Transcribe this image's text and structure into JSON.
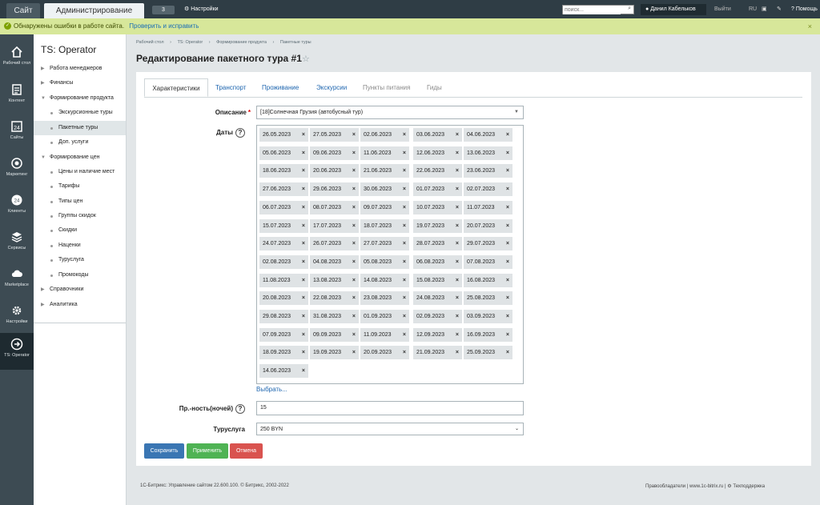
{
  "topbar": {
    "site_tab": "Сайт",
    "admin_tab": "Администрирование",
    "notifications_count": "3",
    "settings_label": "Настройки",
    "search_placeholder": "поиск...",
    "user_name": "Данил Кабельков",
    "logout_label": "Выйти",
    "lang_label": "RU",
    "help_label": "Помощь"
  },
  "errorbar": {
    "message": "Обнаружены ошибки в работе сайта.",
    "link": "Проверить и исправить",
    "close": "×"
  },
  "rail": [
    {
      "label": "Рабочий стол",
      "icon": "home-icon"
    },
    {
      "label": "Контент",
      "icon": "document-icon"
    },
    {
      "label": "Сайты",
      "icon": "calendar-24-icon"
    },
    {
      "label": "Маркетинг",
      "icon": "target-icon"
    },
    {
      "label": "Клиенты",
      "icon": "clock-24-icon"
    },
    {
      "label": "Сервисы",
      "icon": "layers-icon"
    },
    {
      "label": "Marketplace",
      "icon": "cloud-icon"
    },
    {
      "label": "Настройки",
      "icon": "gear-icon"
    },
    {
      "label": "TS: Operator",
      "icon": "arrow-circle-icon"
    }
  ],
  "submenu": {
    "title": "TS: Operator",
    "items": [
      {
        "label": "Работа менеджеров",
        "level": 0,
        "expanded": false
      },
      {
        "label": "Финансы",
        "level": 0,
        "expanded": false
      },
      {
        "label": "Формирование продукта",
        "level": 0,
        "expanded": true
      },
      {
        "label": "Экскурсионные туры",
        "level": 1
      },
      {
        "label": "Пакетные туры",
        "level": 1,
        "active": true
      },
      {
        "label": "Доп. услуги",
        "level": 1
      },
      {
        "label": "Формирование цен",
        "level": 0,
        "expanded": true
      },
      {
        "label": "Цены и наличие мест",
        "level": 1
      },
      {
        "label": "Тарифы",
        "level": 1
      },
      {
        "label": "Типы цен",
        "level": 1
      },
      {
        "label": "Группы скидок",
        "level": 1
      },
      {
        "label": "Скидки",
        "level": 1
      },
      {
        "label": "Наценки",
        "level": 1
      },
      {
        "label": "Туруслуга",
        "level": 1
      },
      {
        "label": "Промокоды",
        "level": 1
      },
      {
        "label": "Справочники",
        "level": 0,
        "expanded": false
      },
      {
        "label": "Аналитика",
        "level": 0,
        "expanded": false
      }
    ]
  },
  "breadcrumb": [
    "Рабочий стол",
    "TS: Operator",
    "Формирование продукта",
    "Пакетные туры"
  ],
  "breadcrumb_sep": "›",
  "page_title": "Редактирование пакетного тура #1",
  "tabs": [
    {
      "label": "Характеристики",
      "active": true
    },
    {
      "label": "Транспорт"
    },
    {
      "label": "Проживание"
    },
    {
      "label": "Экскурсии"
    },
    {
      "label": "Пункты питания",
      "disabled": true
    },
    {
      "label": "Гиды",
      "disabled": true
    }
  ],
  "form": {
    "description_label": "Описание",
    "required_mark": "*",
    "description_value": "[18]Солнечная Грузия (автобусный тур)",
    "dates_label": "Даты",
    "help_mark": "?",
    "dates": [
      "26.05.2023",
      "27.05.2023",
      "02.06.2023",
      "03.06.2023",
      "04.06.2023",
      "05.06.2023",
      "09.06.2023",
      "11.06.2023",
      "12.06.2023",
      "13.06.2023",
      "18.06.2023",
      "20.06.2023",
      "21.06.2023",
      "22.06.2023",
      "23.06.2023",
      "27.06.2023",
      "29.06.2023",
      "30.06.2023",
      "01.07.2023",
      "02.07.2023",
      "06.07.2023",
      "08.07.2023",
      "09.07.2023",
      "10.07.2023",
      "11.07.2023",
      "15.07.2023",
      "17.07.2023",
      "18.07.2023",
      "19.07.2023",
      "20.07.2023",
      "24.07.2023",
      "26.07.2023",
      "27.07.2023",
      "28.07.2023",
      "29.07.2023",
      "02.08.2023",
      "04.08.2023",
      "05.08.2023",
      "06.08.2023",
      "07.08.2023",
      "11.08.2023",
      "13.08.2023",
      "14.08.2023",
      "15.08.2023",
      "16.08.2023",
      "20.08.2023",
      "22.08.2023",
      "23.08.2023",
      "24.08.2023",
      "25.08.2023",
      "29.08.2023",
      "31.08.2023",
      "01.09.2023",
      "02.09.2023",
      "03.09.2023",
      "07.09.2023",
      "09.09.2023",
      "11.09.2023",
      "12.09.2023",
      "16.09.2023",
      "18.09.2023",
      "19.09.2023",
      "20.09.2023",
      "21.09.2023",
      "25.09.2023",
      "14.06.2023"
    ],
    "chip_remove": "×",
    "choose_link": "Выбрать...",
    "duration_label": "Пр.-ность(ночей)",
    "duration_value": "15",
    "service_label": "Туруслуга",
    "service_value": "250 BYN"
  },
  "buttons": {
    "save": "Сохранить",
    "apply": "Применить",
    "cancel": "Отмена"
  },
  "footer": {
    "copyright": "1С-Битрикс: Управление сайтом 22.600.100. © Битрикс, 2002-2022",
    "links": "Правообладатели  |  www.1c-bitrix.ru  |",
    "support": "Техподдержка"
  }
}
